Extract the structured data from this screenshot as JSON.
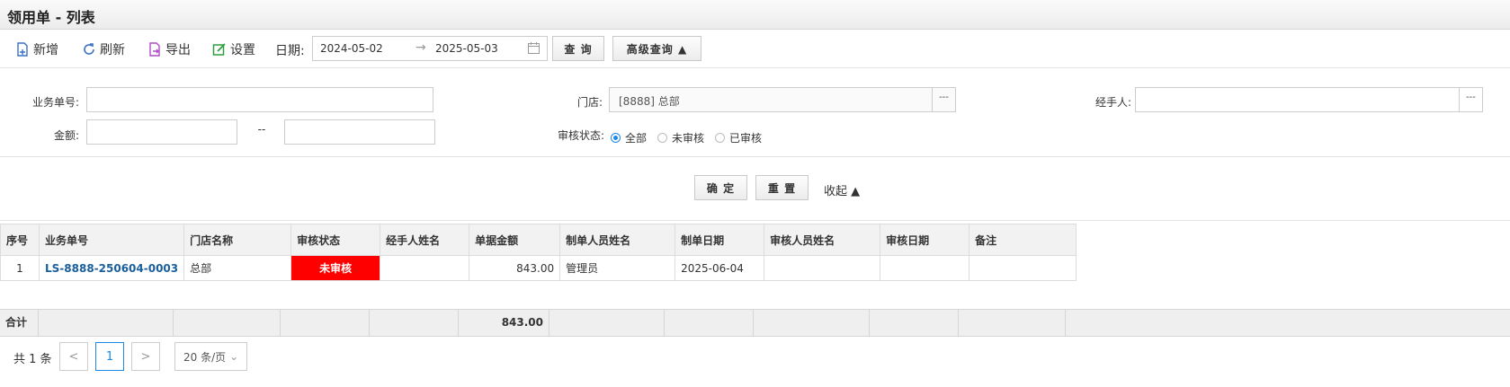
{
  "window": {
    "title": "领用单 - 列表"
  },
  "toolbar": {
    "new_label": "新增",
    "refresh_label": "刷新",
    "export_label": "导出",
    "settings_label": "设置",
    "date_label": "日期:",
    "date_from": "2024-05-02",
    "date_arrow": "→",
    "date_to": "2025-05-03",
    "query_label": "查 询",
    "advanced_label": "高级查询 ▲"
  },
  "filters": {
    "order_no_label": "业务单号:",
    "order_no_value": "",
    "store_label": "门店:",
    "store_value": "[8888] 总部",
    "store_picker": "---",
    "handler_label": "经手人:",
    "handler_value": "",
    "handler_picker": "---",
    "amount_label": "金额:",
    "amount_from": "",
    "amount_sep": "--",
    "amount_to": "",
    "audit_label": "审核状态:",
    "audit_options": [
      "全部",
      "未审核",
      "已审核"
    ],
    "audit_selected": "全部",
    "confirm_label": "确 定",
    "reset_label": "重 置",
    "collapse_label": "收起 ▲"
  },
  "table": {
    "columns": [
      "序号",
      "业务单号",
      "门店名称",
      "审核状态",
      "经手人姓名",
      "单据金额",
      "制单人员姓名",
      "制单日期",
      "审核人员姓名",
      "审核日期",
      "备注"
    ],
    "rows": [
      {
        "index": "1",
        "order_no": "LS-8888-250604-0003",
        "store": "总部",
        "audit_status": "未审核",
        "handler": "",
        "amount": "843.00",
        "creator": "管理员",
        "create_date": "2025-06-04",
        "auditor": "",
        "audit_date": "",
        "remark": ""
      }
    ],
    "summary_label": "合计",
    "summary_amount": "843.00"
  },
  "pager": {
    "total_text": "共 1 条",
    "prev": "<",
    "current_page": "1",
    "next": ">",
    "page_size": "20 条/页"
  },
  "colors": {
    "accent": "#1e88e5",
    "link": "#1a5e9a",
    "unaudited_bg": "#ff0000"
  }
}
